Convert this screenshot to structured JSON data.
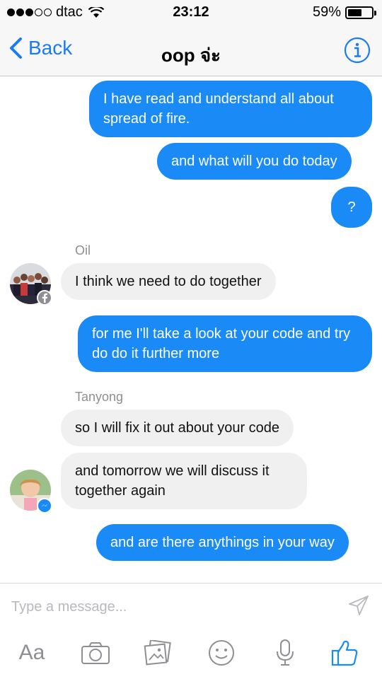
{
  "status_bar": {
    "carrier": "dtac",
    "time": "23:12",
    "battery": "59%",
    "battery_level": 0.59
  },
  "nav": {
    "back_label": "Back",
    "title": "oop จ่ะ"
  },
  "messages": [
    {
      "direction": "outgoing",
      "text": "I have read and understand all about spread of fire."
    },
    {
      "direction": "outgoing",
      "text": "and what will you do today"
    },
    {
      "direction": "outgoing",
      "text": "?"
    },
    {
      "direction": "incoming",
      "sender": "Oil",
      "text": "I think we need to do together"
    },
    {
      "direction": "outgoing",
      "text": "for me I'll take a look at your code and try do do it further more"
    },
    {
      "direction": "incoming",
      "sender": "Tanyong",
      "text": "so I will fix it out about your code"
    },
    {
      "direction": "incoming",
      "text": "and tomorrow we will discuss it together again"
    },
    {
      "direction": "outgoing",
      "text": "and are there anythings in your way"
    }
  ],
  "composer": {
    "placeholder": "Type a message...",
    "value": "",
    "tools": [
      "text-format-icon",
      "camera-icon",
      "photo-gallery-icon",
      "sticker-icon",
      "microphone-icon",
      "like-icon"
    ],
    "aa_label": "Aa"
  },
  "colors": {
    "accent": "#1a8af6",
    "incoming_bubble": "#f0f0f0",
    "nav_bg": "#f7f7f7"
  }
}
